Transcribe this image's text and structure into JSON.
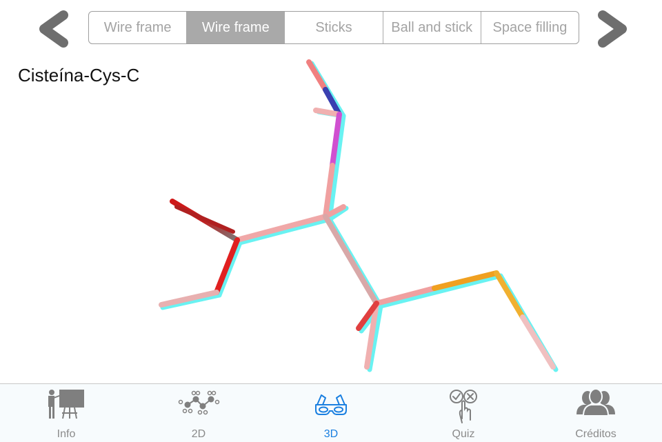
{
  "nav": {
    "prev_icon": "chevron-left-icon",
    "next_icon": "chevron-right-icon"
  },
  "render_modes": {
    "selected_index": 1,
    "items": [
      {
        "label": "Wire frame"
      },
      {
        "label": "Wire frame"
      },
      {
        "label": "Sticks"
      },
      {
        "label": "Ball and stick"
      },
      {
        "label": "Space filling"
      }
    ]
  },
  "molecule": {
    "title": "Cisteína-Cys-C",
    "render_style": "anaglyph-3d",
    "colors": {
      "carbon": "#8a8a8a",
      "oxygen": "#e02020",
      "nitrogen": "#3040c0",
      "sulfur": "#f0a020",
      "hydrogen": "#f0d0d0",
      "anaglyph_red": "#ff8080",
      "anaglyph_cyan": "#40f0f0"
    }
  },
  "tabbar": {
    "active_index": 2,
    "accent_color": "#1a7fe0",
    "items": [
      {
        "label": "Info",
        "icon": "teacher-board-icon"
      },
      {
        "label": "2D",
        "icon": "molecule-2d-icon"
      },
      {
        "label": "3D",
        "icon": "3d-glasses-icon"
      },
      {
        "label": "Quiz",
        "icon": "quiz-hand-icon"
      },
      {
        "label": "Créditos",
        "icon": "people-icon"
      }
    ]
  }
}
